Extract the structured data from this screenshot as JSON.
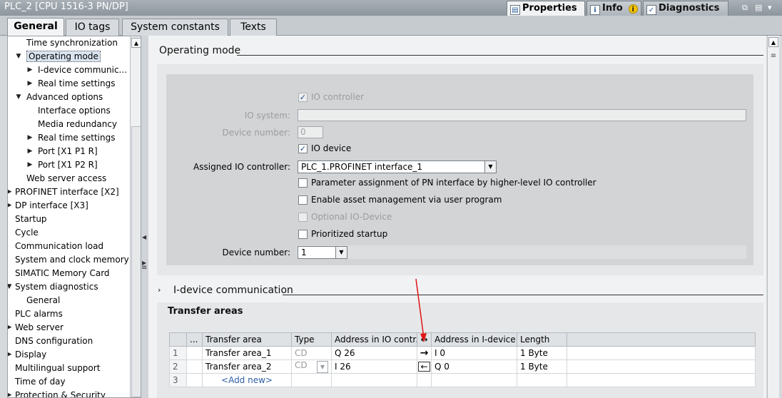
{
  "window": {
    "title": "PLC_2 [CPU 1516-3 PN/DP]",
    "panel_tabs": [
      "Properties",
      "Info",
      "Diagnostics"
    ],
    "window_controls": [
      "⧉",
      "▤",
      "▾"
    ]
  },
  "tabs": [
    "General",
    "IO tags",
    "System constants",
    "Texts"
  ],
  "nav": {
    "items": [
      {
        "label": "Time synchronization",
        "arrow": ""
      },
      {
        "label": "Operating mode",
        "arrow": "▼"
      },
      {
        "label": "I-device communic...",
        "arrow": "▶"
      },
      {
        "label": "Real time settings",
        "arrow": "▶"
      },
      {
        "label": "Advanced options",
        "arrow": "▼"
      },
      {
        "label": "Interface options",
        "arrow": ""
      },
      {
        "label": "Media redundancy",
        "arrow": ""
      },
      {
        "label": "Real time settings",
        "arrow": "▶"
      },
      {
        "label": "Port [X1 P1 R]",
        "arrow": "▶"
      },
      {
        "label": "Port [X1 P2 R]",
        "arrow": "▶"
      },
      {
        "label": "Web server access",
        "arrow": ""
      },
      {
        "label": "PROFINET interface [X2]",
        "arrow": "▶"
      },
      {
        "label": "DP interface [X3]",
        "arrow": "▶"
      },
      {
        "label": "Startup",
        "arrow": ""
      },
      {
        "label": "Cycle",
        "arrow": ""
      },
      {
        "label": "Communication load",
        "arrow": ""
      },
      {
        "label": "System and clock memory",
        "arrow": ""
      },
      {
        "label": "SIMATIC Memory Card",
        "arrow": ""
      },
      {
        "label": "System diagnostics",
        "arrow": "▼"
      },
      {
        "label": "General",
        "arrow": ""
      },
      {
        "label": "PLC alarms",
        "arrow": ""
      },
      {
        "label": "Web server",
        "arrow": "▶"
      },
      {
        "label": "DNS configuration",
        "arrow": ""
      },
      {
        "label": "Display",
        "arrow": "▶"
      },
      {
        "label": "Multilingual support",
        "arrow": ""
      },
      {
        "label": "Time of day",
        "arrow": ""
      },
      {
        "label": "Protection & Security",
        "arrow": "▶"
      }
    ]
  },
  "operating_mode": {
    "title": "Operating mode",
    "io_controller_label": "IO controller",
    "io_system_label": "IO system:",
    "io_system_value": "",
    "device_number_label": "Device number:",
    "device_number_value": "0",
    "io_device_label": "IO device",
    "assigned_label": "Assigned IO controller:",
    "assigned_value": "PLC_1.PROFINET interface_1",
    "param_assign_label": "Parameter assignment of PN interface by higher-level IO controller",
    "asset_mgmt_label": "Enable asset management via user program",
    "optional_label": "Optional IO-Device",
    "prioritized_label": "Prioritized startup",
    "device_number2_label": "Device number:",
    "device_number2_value": "1"
  },
  "idevice": {
    "title": "I-device communication",
    "transfer_areas_title": "Transfer areas",
    "columns": [
      "",
      "...",
      "Transfer area",
      "Type",
      "Address in IO contr...",
      "↔",
      "Address in I-device",
      "Length",
      ""
    ],
    "rows": [
      {
        "num": "1",
        "name": "Transfer area_1",
        "type": "CD",
        "addr_ctrl": "Q 26",
        "dir": "→",
        "addr_dev": "I 0",
        "length": "1 Byte"
      },
      {
        "num": "2",
        "name": "Transfer area_2",
        "type": "CD",
        "addr_ctrl": "I 26",
        "dir": "←",
        "addr_dev": "Q 0",
        "length": "1 Byte"
      },
      {
        "num": "3",
        "name": "<Add new>",
        "type": "",
        "addr_ctrl": "",
        "dir": "",
        "addr_dev": "",
        "length": ""
      }
    ]
  },
  "colors": {
    "accent": "#1b4f86",
    "annotation_arrow": "#e01515",
    "selection": "#d9e4ef"
  }
}
